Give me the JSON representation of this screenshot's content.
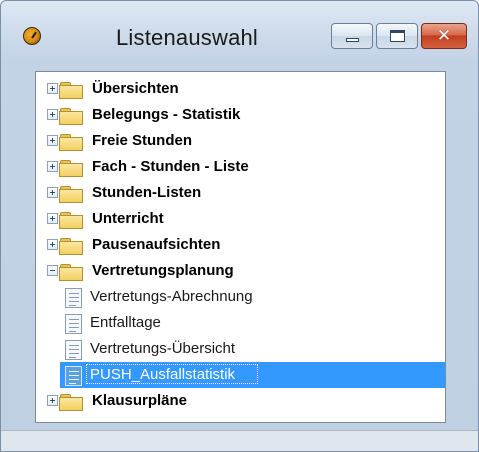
{
  "window": {
    "title": "Listenauswahl",
    "title_color": "#1a1a1a",
    "close_color": "#c2401f"
  },
  "titlebar": {
    "minimize_icon": "minimize-icon",
    "maximize_icon": "maximize-icon",
    "close_icon": "close-icon",
    "close_glyph": "✕"
  },
  "tree": {
    "selection_color": "#3399ff",
    "folder_icon": "folder-icon",
    "document_icon": "report-icon",
    "items": [
      {
        "label": "Übersichten",
        "kind": "folder",
        "expanded": false
      },
      {
        "label": "Belegungs - Statistik",
        "kind": "folder",
        "expanded": false
      },
      {
        "label": "Freie Stunden",
        "kind": "folder",
        "expanded": false
      },
      {
        "label": "Fach - Stunden - Liste",
        "kind": "folder",
        "expanded": false
      },
      {
        "label": "Stunden-Listen",
        "kind": "folder",
        "expanded": false
      },
      {
        "label": "Unterricht",
        "kind": "folder",
        "expanded": false
      },
      {
        "label": "Pausenaufsichten",
        "kind": "folder",
        "expanded": false
      },
      {
        "label": "Vertretungsplanung",
        "kind": "folder",
        "expanded": true
      },
      {
        "label": "Vertretungs-Abrechnung",
        "kind": "document",
        "selected": false
      },
      {
        "label": "Entfalltage",
        "kind": "document",
        "selected": false
      },
      {
        "label": "Vertretungs-Übersicht",
        "kind": "document",
        "selected": false
      },
      {
        "label": "PUSH_Ausfallstatistik",
        "kind": "document",
        "selected": true
      },
      {
        "label": "Klausurpläne",
        "kind": "folder",
        "expanded": false
      }
    ]
  }
}
